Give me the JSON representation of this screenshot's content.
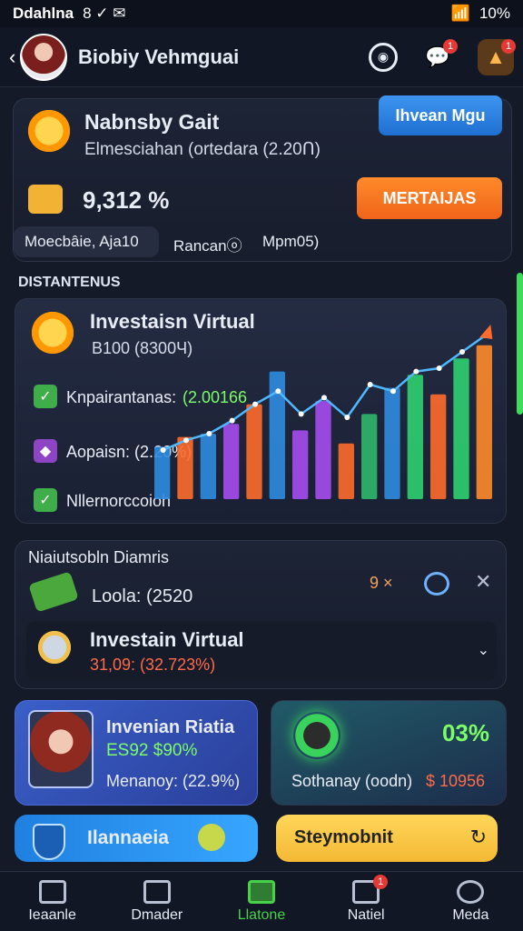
{
  "status": {
    "carrier": "Ddahlna",
    "icons": "8 ✓ ✉",
    "battery": "10%"
  },
  "header": {
    "title": "Biobiy Vehmguai",
    "notif_badge": "1",
    "profile_badge": "1"
  },
  "top_card": {
    "name": "Nabnsby Gait",
    "subtitle": "Elmesciahan (ortedara (2.20Ո)",
    "cta_label": "Ihvean Mgu",
    "value": "9,312 %",
    "orange_label": "MERTAIJAS",
    "chip1": "Moecbâie, Aja10",
    "chip2": "Rancanⓞ",
    "chip3": "Mpm05)"
  },
  "section1_title": "DISTANTENUS",
  "chart_card": {
    "title": "Investaisn Virtual",
    "subtitle": "B100 (8300Ч)",
    "row1": "Knpairantanas:",
    "row1_value": "(2.00166",
    "row2": "Aopaisn: (2.20%)",
    "row3": "Nllernorccoioh"
  },
  "chart_data": {
    "type": "bar",
    "series": [
      {
        "values": [
          32,
          38,
          40,
          46,
          58,
          78,
          42,
          60,
          34,
          52,
          68,
          76,
          64,
          86,
          94
        ]
      }
    ],
    "trend": [
      30,
      36,
      40,
      48,
      58,
      66,
      52,
      62,
      50,
      70,
      66,
      78,
      80,
      90,
      100
    ]
  },
  "section2": {
    "title": "Niaiutsobln Diamris",
    "row1": "Loola: (2520",
    "row1_meta": "9 ×",
    "inner_title": "Investain Virtual",
    "inner_sub": "31,09: (32.723%)"
  },
  "card_person": {
    "name": "Invenian Riatia",
    "line": "ES92 $90%",
    "line2": "Menanoy: (22.9%)"
  },
  "card_pct": {
    "value": "03%",
    "line": "Sothanay (oodn)",
    "line_value": "$ 10956"
  },
  "card_blue": {
    "label": "Ilannaeia"
  },
  "card_yellow": {
    "label": "Steymobnit"
  },
  "nav": [
    {
      "label": "Ieaanle"
    },
    {
      "label": "Dmader"
    },
    {
      "label": "Llatone"
    },
    {
      "label": "Natiel",
      "badge": "1"
    },
    {
      "label": "Meda"
    }
  ],
  "colors": {
    "accent_green": "#48d24a",
    "accent_orange": "#ff7a1a",
    "accent_blue": "#1f80e0"
  }
}
